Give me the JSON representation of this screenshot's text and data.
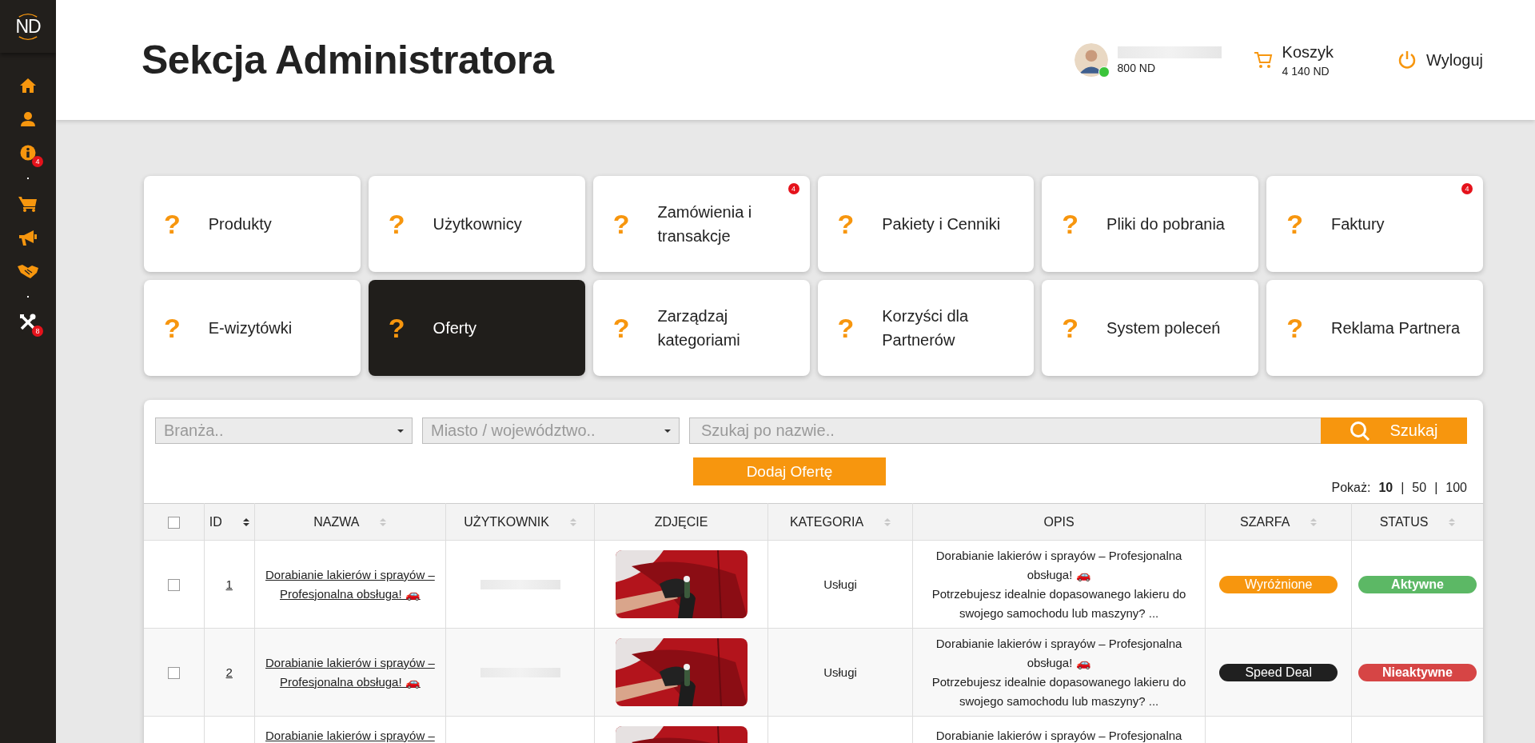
{
  "logo": {
    "text": "ND"
  },
  "sidebar": {
    "items": [
      {
        "kind": "home"
      },
      {
        "kind": "user"
      },
      {
        "kind": "info",
        "badge": "4"
      },
      {
        "kind": "dot"
      },
      {
        "kind": "cart"
      },
      {
        "kind": "megaphone"
      },
      {
        "kind": "handshake"
      },
      {
        "kind": "dot"
      },
      {
        "kind": "tools",
        "badge": "8"
      }
    ]
  },
  "header": {
    "title": "Sekcja Administratora",
    "user": {
      "points": "800 ND",
      "online": true
    },
    "cart": {
      "label": "Koszyk",
      "amount": "4 140 ND"
    },
    "logout": "Wyloguj"
  },
  "tiles": [
    {
      "icon": "?",
      "label": "Produkty",
      "selected": false
    },
    {
      "icon": "?",
      "label": "Użytkownicy",
      "selected": false
    },
    {
      "icon": "?",
      "label": "Zamówienia i transakcje",
      "selected": false,
      "badge": "4"
    },
    {
      "icon": "?",
      "label": "Pakiety i Cenniki",
      "selected": false
    },
    {
      "icon": "?",
      "label": "Pliki do pobrania",
      "selected": false
    },
    {
      "icon": "?",
      "label": "Faktury",
      "selected": false,
      "badge": "4"
    },
    {
      "icon": "?",
      "label": "E-wizytówki",
      "selected": false
    },
    {
      "icon": "?",
      "label": "Oferty",
      "selected": true
    },
    {
      "icon": "?",
      "label": "Zarządzaj kategoriami",
      "selected": false
    },
    {
      "icon": "?",
      "label": "Korzyści dla Partnerów",
      "selected": false
    },
    {
      "icon": "?",
      "label": "System poleceń",
      "selected": false
    },
    {
      "icon": "?",
      "label": "Reklama Partnera",
      "selected": false
    }
  ],
  "filters": {
    "industry": {
      "placeholder": "Branża.."
    },
    "city": {
      "placeholder": "Miasto / województwo.."
    },
    "search": {
      "placeholder": "Szukaj po nazwie.."
    },
    "search_button": "Szukaj",
    "add_button": "Dodaj Ofertę",
    "page_size": {
      "label": "Pokaż:",
      "separator": "|",
      "options": [
        {
          "label": "10",
          "selected": true
        },
        {
          "label": "50",
          "selected": false
        },
        {
          "label": "100",
          "selected": false
        }
      ]
    }
  },
  "table": {
    "columns": [
      {
        "kind": "checkbox",
        "checked": false
      },
      {
        "kind": "text",
        "label": "ID",
        "sorted": true
      },
      {
        "kind": "text",
        "label": "NAZWA",
        "sorted": false
      },
      {
        "kind": "text",
        "label": "UŻYTKOWNIK",
        "sorted": false
      },
      {
        "kind": "text",
        "label": "ZDJĘCIE"
      },
      {
        "kind": "text",
        "label": "KATEGORIA",
        "sorted": false
      },
      {
        "kind": "text",
        "label": "OPIS"
      },
      {
        "kind": "text",
        "label": "SZARFA",
        "sorted": false
      },
      {
        "kind": "text",
        "label": "STATUS",
        "sorted": false
      }
    ],
    "rows": [
      {
        "checked": false,
        "id": "1",
        "name": "Dorabianie lakierów i sprayów – Profesjonalna obsługa! 🚗",
        "user_blurred": true,
        "photo": {
          "kind": "picture"
        },
        "category": "Usługi",
        "description": [
          "Dorabianie lakierów i sprayów – Profesjonalna obsługa! 🚗",
          "Potrzebujesz idealnie dopasowanego lakieru do swojego samochodu lub maszyny? ..."
        ],
        "sash": {
          "label": "Wyróżnione",
          "color": "#f7960e"
        },
        "status": {
          "label": "Aktywne",
          "color": "#5cb865"
        }
      },
      {
        "checked": false,
        "id": "2",
        "name": "Dorabianie lakierów i sprayów – Profesjonalna obsługa! 🚗",
        "user_blurred": true,
        "photo": {
          "kind": "picture"
        },
        "category": "Usługi",
        "description": [
          "Dorabianie lakierów i sprayów – Profesjonalna obsługa! 🚗",
          "Potrzebujesz idealnie dopasowanego lakieru do swojego samochodu lub maszyny? ..."
        ],
        "sash": {
          "label": "Speed Deal",
          "color": "#202020"
        },
        "status": {
          "label": "Nieaktywne",
          "color": "#d64545"
        }
      },
      {
        "name": "Dorabianie lakierów i sprayów –",
        "photo": {
          "kind": "picture"
        },
        "description": [
          "Dorabianie lakierów i sprayów – Profesjonalna"
        ]
      }
    ]
  }
}
